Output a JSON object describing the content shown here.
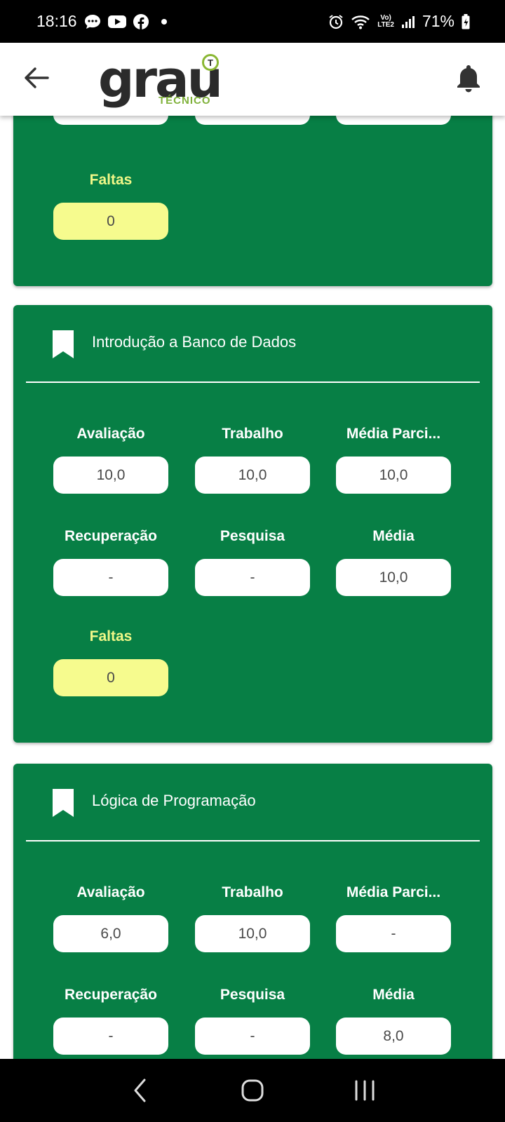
{
  "status_bar": {
    "time": "18:16",
    "battery": "71%",
    "lte_top": "Vo)",
    "lte_bottom": "LTE2",
    "left_icons": [
      "chat-bubble-icon",
      "youtube-icon",
      "facebook-icon",
      "dot-icon"
    ],
    "right_icons": [
      "alarm-icon",
      "wifi-icon",
      "lte-icon",
      "signal-icon",
      "battery-icon"
    ]
  },
  "header": {
    "logo_main": "grau",
    "logo_sub": "TÉCNICO",
    "logo_badge": "T",
    "back_icon": "arrow-left-icon",
    "bell_icon": "bell-icon"
  },
  "colors": {
    "card_green": "#077f45",
    "faltas_yellow": "#f6fb8e",
    "faltas_label": "#f1f888",
    "logo_green": "#7fb13a"
  },
  "cards": [
    {
      "title": "",
      "row1": [
        "-",
        "-",
        "-"
      ],
      "faltas_label": "Faltas",
      "faltas_value": "0"
    },
    {
      "title": "Introdução a Banco de Dados",
      "labels_row1": [
        "Avaliação",
        "Trabalho",
        "Média Parci..."
      ],
      "values_row1": [
        "10,0",
        "10,0",
        "10,0"
      ],
      "labels_row2": [
        "Recuperação",
        "Pesquisa",
        "Média"
      ],
      "values_row2": [
        "-",
        "-",
        "10,0"
      ],
      "faltas_label": "Faltas",
      "faltas_value": "0"
    },
    {
      "title": "Lógica de Programação",
      "labels_row1": [
        "Avaliação",
        "Trabalho",
        "Média Parci..."
      ],
      "values_row1": [
        "6,0",
        "10,0",
        "-"
      ],
      "labels_row2": [
        "Recuperação",
        "Pesquisa",
        "Média"
      ],
      "values_row2": [
        "-",
        "-",
        "8,0"
      ]
    }
  ],
  "nav_bar": {
    "icons": [
      "back-nav-icon",
      "home-nav-icon",
      "recents-nav-icon"
    ]
  }
}
